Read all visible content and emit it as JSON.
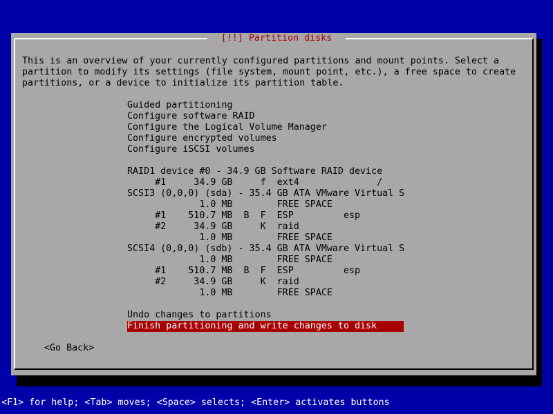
{
  "dialog": {
    "title": "[!!] Partition disks",
    "description": [
      "This is an overview of your currently configured partitions and mount points. Select a",
      "partition to modify its settings (file system, mount point, etc.), a free space to create",
      "partitions, or a device to initialize its partition table."
    ]
  },
  "menu": {
    "actions": [
      "Guided partitioning",
      "Configure software RAID",
      "Configure the Logical Volume Manager",
      "Configure encrypted volumes",
      "Configure iSCSI volumes"
    ],
    "partitions": [
      "RAID1 device #0 - 34.9 GB Software RAID device",
      "     #1     34.9 GB     f  ext4              /",
      "SCSI3 (0,0,0) (sda) - 35.4 GB ATA VMware Virtual S",
      "             1.0 MB        FREE SPACE",
      "     #1    510.7 MB  B  F  ESP         esp",
      "     #2     34.9 GB     K  raid",
      "             1.0 MB        FREE SPACE",
      "SCSI4 (0,0,0) (sdb) - 35.4 GB ATA VMware Virtual S",
      "             1.0 MB        FREE SPACE",
      "     #1    510.7 MB  B  F  ESP         esp",
      "     #2     34.9 GB     K  raid",
      "             1.0 MB        FREE SPACE"
    ],
    "undo": "Undo changes to partitions",
    "finish": "Finish partitioning and write changes to disk"
  },
  "go_back": "<Go Back>",
  "footer": "<F1> for help; <Tab> moves; <Space> selects; <Enter> activates buttons"
}
